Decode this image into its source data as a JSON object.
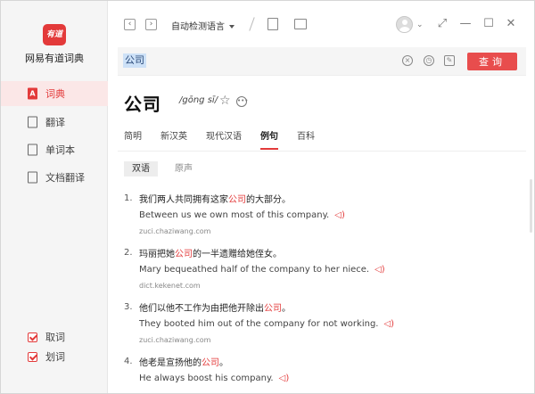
{
  "sidebar": {
    "logo_text": "有道",
    "brand": "网易有道词典",
    "items": [
      {
        "label": "词典",
        "icon": "dictionary-icon",
        "active": true
      },
      {
        "label": "翻译",
        "icon": "translate-icon",
        "active": false
      },
      {
        "label": "单词本",
        "icon": "wordbook-icon",
        "active": false
      },
      {
        "label": "文档翻译",
        "icon": "document-icon",
        "active": false
      }
    ],
    "checks": [
      {
        "label": "取词",
        "checked": true
      },
      {
        "label": "划词",
        "checked": true
      }
    ]
  },
  "topbar": {
    "language": "自动检测语言"
  },
  "search": {
    "value": "公司",
    "button": "查询"
  },
  "entry": {
    "word": "公司",
    "pinyin": "/gōng sī/"
  },
  "tabs": [
    "简明",
    "新汉英",
    "现代汉语",
    "例句",
    "百科"
  ],
  "active_tab": "例句",
  "subtabs": [
    "双语",
    "原声"
  ],
  "examples": [
    {
      "num": "1.",
      "zh_pre": "我们两人共同拥有这家",
      "zh_hl": "公司",
      "zh_post": "的大部分。",
      "en": "Between us we own most of this company.",
      "src": "zuci.chaziwang.com"
    },
    {
      "num": "2.",
      "zh_pre": "玛丽把她",
      "zh_hl": "公司",
      "zh_post": "的一半遗赠给她侄女。",
      "en": "Mary bequeathed half of the company to her niece.",
      "src": "dict.kekenet.com"
    },
    {
      "num": "3.",
      "zh_pre": "他们以他不工作为由把他开除出",
      "zh_hl": "公司",
      "zh_post": "。",
      "en": "They booted him out of the company for not working.",
      "src": "zuci.chaziwang.com"
    },
    {
      "num": "4.",
      "zh_pre": "他老是宣扬他的",
      "zh_hl": "公司",
      "zh_post": "。",
      "en": "He always boost his company.",
      "src": ""
    }
  ],
  "colors": {
    "accent": "#e33a3a",
    "button": "#e84d4d"
  }
}
